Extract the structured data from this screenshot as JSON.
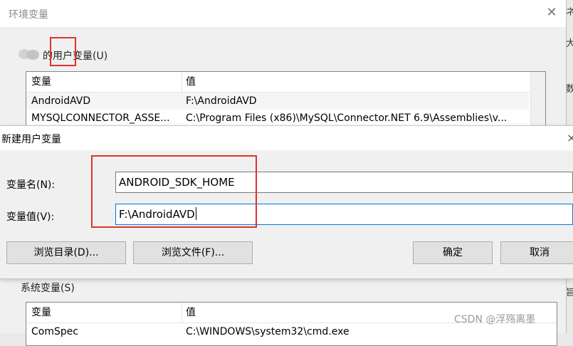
{
  "env_window": {
    "title": "环境变量",
    "close_glyph": "✕",
    "user_vars_label": "的用户变量(U)",
    "user_grid": {
      "columns": [
        "变量",
        "值"
      ],
      "rows": [
        {
          "name": "AndroidAVD",
          "value": "F:\\AndroidAVD"
        },
        {
          "name": "MYSQLCONNECTOR_ASSE...",
          "value": "C:\\Program Files (x86)\\MySQL\\Connector.NET 6.9\\Assemblies\\v..."
        }
      ]
    },
    "system_vars_label": "系统变量(S)",
    "system_grid": {
      "columns": [
        "变量",
        "值"
      ],
      "rows": [
        {
          "name": "ComSpec",
          "value": "C:\\WINDOWS\\system32\\cmd.exe"
        }
      ]
    }
  },
  "background_edge": {
    "chars": [
      "ネ",
      "大",
      "数",
      "旨"
    ]
  },
  "new_var_dialog": {
    "title": "新建用户变量",
    "close_glyph": "×",
    "name_label": "变量名(N):",
    "name_value": "ANDROID_SDK_HOME",
    "value_label": "变量值(V):",
    "value_value": "F:\\AndroidAVD",
    "buttons": {
      "browse_dir": "浏览目录(D)...",
      "browse_file": "浏览文件(F)...",
      "ok": "确定",
      "cancel": "取消"
    }
  },
  "watermark": "CSDN @浮殇离墨",
  "colors": {
    "annotation": "#e0322e",
    "focus_border": "#0078d7"
  }
}
